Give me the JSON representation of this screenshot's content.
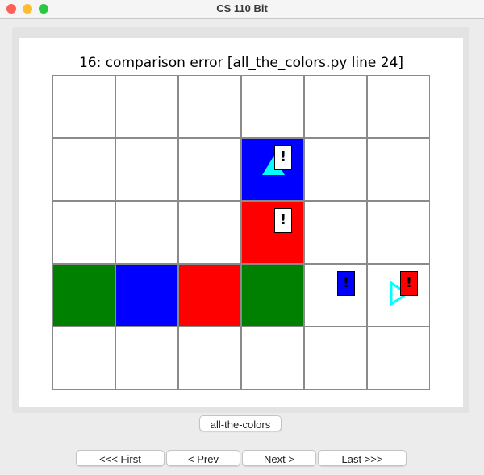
{
  "window": {
    "title": "CS 110 Bit"
  },
  "heading": "16: comparison error  [all_the_colors.py line 24]",
  "grid": {
    "cols": 6,
    "rows": 5,
    "colors": {
      "white": "#ffffff",
      "blue": "#0000ff",
      "red": "#ff0000",
      "green": "#008000",
      "cyan": "#00ffff"
    },
    "cells": [
      [
        "white",
        "white",
        "white",
        "white",
        "white",
        "white"
      ],
      [
        "white",
        "white",
        "white",
        "blue",
        "white",
        "white"
      ],
      [
        "white",
        "white",
        "white",
        "red",
        "white",
        "white"
      ],
      [
        "green",
        "blue",
        "red",
        "green",
        "white",
        "white"
      ],
      [
        "white",
        "white",
        "white",
        "white",
        "white",
        "white"
      ]
    ],
    "markers": [
      {
        "row": 1,
        "col": 3,
        "mark": "!",
        "color": "white"
      },
      {
        "row": 2,
        "col": 3,
        "mark": "!",
        "color": "white"
      },
      {
        "row": 3,
        "col": 4,
        "mark": "!",
        "color": "blue"
      },
      {
        "row": 3,
        "col": 5,
        "mark": "!",
        "color": "red"
      }
    ],
    "bits": [
      {
        "row": 1,
        "col": 3,
        "direction": "up",
        "style": "filled",
        "color": "cyan"
      },
      {
        "row": 3,
        "col": 5,
        "direction": "right",
        "style": "outline",
        "color": "cyan"
      }
    ]
  },
  "buttons": {
    "name": "all-the-colors",
    "first": "<<< First",
    "prev": "< Prev",
    "next": "Next >",
    "last": "Last >>>"
  }
}
